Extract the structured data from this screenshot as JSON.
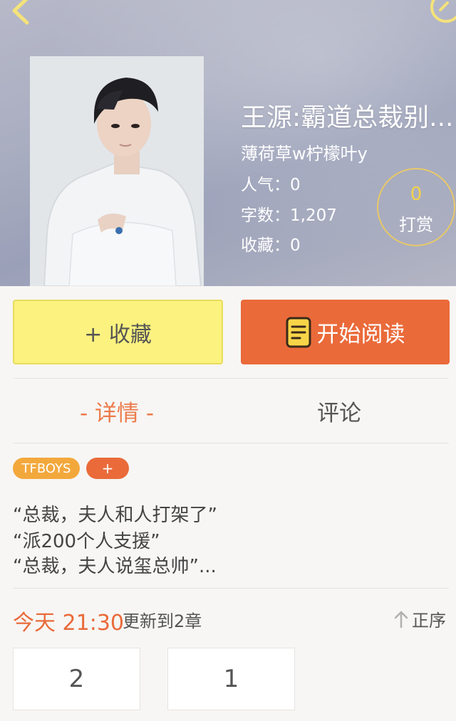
{
  "header": {
    "back_icon": "chevron-left-icon",
    "refresh_icon": "refresh-icon"
  },
  "book": {
    "title": "王源:霸道总裁别...",
    "author": "薄荷草w柠檬叶y",
    "popularity": "人气：0",
    "word_count": "字数：1,207",
    "favorites": "收藏：0"
  },
  "tip": {
    "count": "0",
    "label": "打赏"
  },
  "actions": {
    "collect_label": "+ 收藏",
    "read_label": "开始阅读",
    "read_icon": "book-icon"
  },
  "tabs": {
    "detail": "- 详情 -",
    "comment": "评论"
  },
  "tags": {
    "items": [
      "TFBOYS"
    ],
    "add_label": "+"
  },
  "description": {
    "lines": [
      "“总裁，夫人和人打架了”",
      "“派200个人支援”",
      "“总裁，夫人说玺总帅”..."
    ]
  },
  "update": {
    "time": "今天 21:30",
    "text": "更新到2章",
    "sort_label": "正序",
    "sort_icon": "arrow-up-icon"
  },
  "chapters": [
    "2",
    "1"
  ],
  "colors": {
    "accent_orange": "#ea6a3a",
    "collect_yellow": "#fbf27f",
    "tag_orange": "#f3a83c",
    "tip_gold": "#f3d34a"
  }
}
